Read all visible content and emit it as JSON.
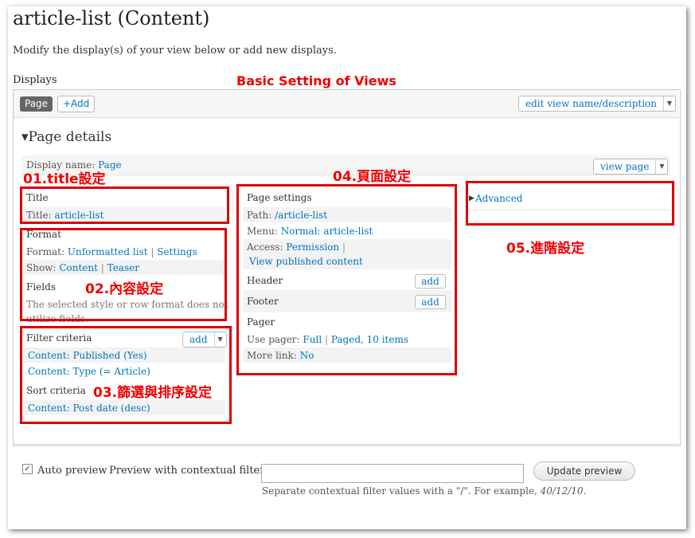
{
  "page": {
    "title": "article-list (Content)",
    "intro": "Modify the display(s) of your view below or add new displays.",
    "displays_label": "Displays",
    "annotation_top": "Basic Setting of Views"
  },
  "tabs": {
    "page_tab": "Page",
    "add_tab": "+Add",
    "edit_button": "edit view name/description"
  },
  "details": {
    "heading": "▾Page details",
    "display_name_label": "Display name:",
    "display_name_value": "Page",
    "view_page_button": "view page"
  },
  "title_section": {
    "heading": "Title",
    "label": "Title:",
    "value": "article-list"
  },
  "format_section": {
    "heading": "Format",
    "format_label": "Format:",
    "format_value": "Unformatted list",
    "settings": "Settings",
    "show_label": "Show:",
    "show_value": "Content",
    "teaser": "Teaser",
    "fields_heading": "Fields",
    "fields_note_1": "The selected style or row format does not",
    "fields_note_2": "utilize fields."
  },
  "filter_section": {
    "heading": "Filter criteria",
    "add": "add",
    "items": [
      "Content: Published (Yes)",
      "Content: Type (= Article)"
    ],
    "sort_heading": "Sort criteria",
    "sort_items": [
      "Content: Post date (desc)"
    ]
  },
  "page_settings": {
    "heading": "Page settings",
    "path_label": "Path:",
    "path_value": "/article-list",
    "menu_label": "Menu:",
    "menu_value": "Normal: article-list",
    "access_label": "Access:",
    "access_value": "Permission",
    "access_value_2": "View published content",
    "header": "Header",
    "footer": "Footer",
    "add": "add",
    "pager_heading": "Pager",
    "use_pager_label": "Use pager:",
    "use_pager_value": "Full",
    "use_pager_value_2": "Paged, 10 items",
    "more_link_label": "More link:",
    "more_link_value": "No"
  },
  "advanced": {
    "label": "Advanced"
  },
  "annotations": {
    "a01": "01.title設定",
    "a02": "02.內容設定",
    "a03": "03.篩選與排序設定",
    "a04": "04.頁面設定",
    "a05": "05.進階設定"
  },
  "preview": {
    "auto_preview": "Auto preview",
    "contextual_label": "Preview with contextual filters:",
    "input_value": "",
    "update_button": "Update preview",
    "help_prefix": "Separate contextual filter values with a \"/\". For example, ",
    "help_example": "40/12/10",
    "help_suffix": "."
  },
  "colors": {
    "annotation_red": "#e00000",
    "link_blue": "#0074bd",
    "box_red": "#d00000"
  }
}
